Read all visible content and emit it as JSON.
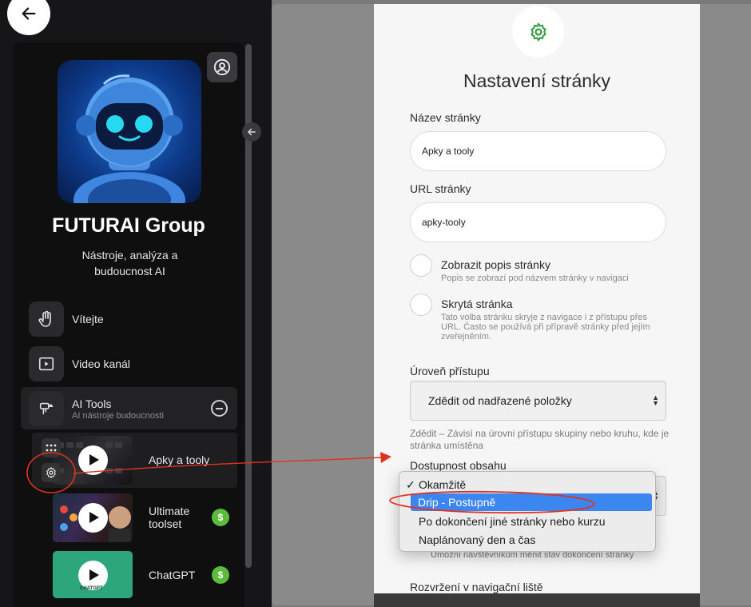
{
  "sidebar": {
    "brand_title": "FUTURAI Group",
    "brand_subtitle": "Nástroje, analýza a budoucnost AI",
    "items": [
      {
        "label": "Vítejte",
        "icon": "hand-icon"
      },
      {
        "label": "Video kanál",
        "icon": "video-icon"
      }
    ],
    "group": {
      "label": "AI Tools",
      "subtitle": "AI nástroje budoucnosti",
      "icon": "tools-icon"
    },
    "sub_items": [
      {
        "label": "Apky a tooly"
      },
      {
        "label": "Ultimate toolset",
        "badge": "$"
      },
      {
        "label": "ChatGPT",
        "badge": "$",
        "thumb_caption": "CHATGPT"
      }
    ]
  },
  "dialog": {
    "title": "Nastavení stránky",
    "page_name_label": "Název stránky",
    "page_name_value": "Apky a tooly",
    "url_label": "URL stránky",
    "url_value": "apky-tooly",
    "show_desc_title": "Zobrazit popis stránky",
    "show_desc_help": "Popis se zobrazí pod názvem stránky v navigaci",
    "hidden_title": "Skrytá stránka",
    "hidden_help": "Tato volba stránku skryje z navigace i z přístupu přes URL. Často se používá při přípravě stránky před jejím zveřejněním.",
    "access_label": "Úroveň přístupu",
    "access_value": "Zdědit od nadřazené položky",
    "access_help": "Zdědit – Závisí na úrovni přístupu skupiny nebo kruhu, kde je stránka umístěna",
    "availability_label": "Dostupnost obsahu",
    "availability_options": [
      "Okamžitě",
      "Drip - Postupně",
      "Po dokončení jiné stránky nebo kurzu",
      "Naplánovaný den a čas"
    ],
    "partial_help": "Umožní návštěvníkům měnit stav dokončení stránky",
    "nav_layout_label": "Rozvržení v navigační liště"
  },
  "colors": {
    "accent_blue": "#3c86f0",
    "annotation_red": "#e0331f",
    "badge_green": "#5dbb3b",
    "gear_green": "#2e9b3a"
  }
}
